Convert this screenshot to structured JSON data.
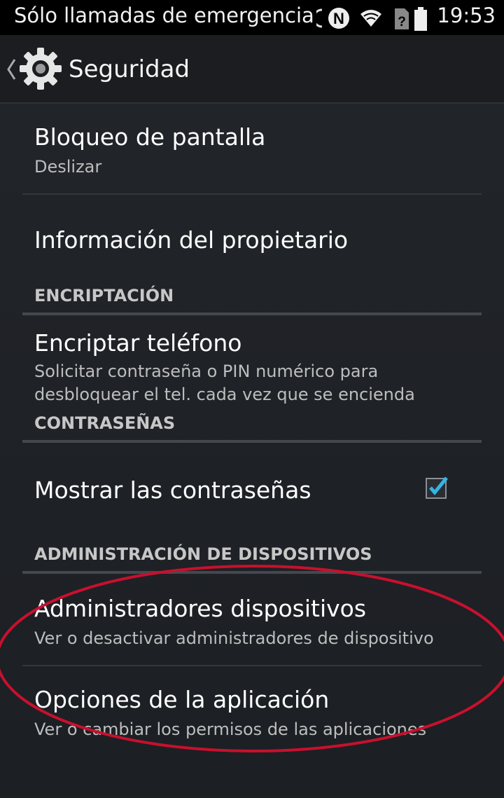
{
  "status_bar": {
    "carrier_text": "Sólo llamadas de emergencia",
    "time": "19:53",
    "icons": [
      "sync-icon",
      "nfc-icon",
      "wifi-icon",
      "no-sim-icon",
      "battery-icon"
    ]
  },
  "action_bar": {
    "title": "Seguridad",
    "icon": "settings-gear-icon",
    "back": "chevron-left-icon"
  },
  "items": {
    "screen_lock": {
      "title": "Bloqueo de pantalla",
      "summary": "Deslizar"
    },
    "owner_info": {
      "title": "Información del propietario"
    },
    "encrypt_header": "ENCRIPTACIÓN",
    "encrypt_phone": {
      "title": "Encriptar teléfono",
      "summary_line1": "Solicitar contraseña o PIN numérico para",
      "summary_line2": "desbloquear el tel. cada vez que se encienda"
    },
    "passwords_header": "CONTRASEÑAS",
    "show_passwords": {
      "title": "Mostrar las contraseñas",
      "checked": true
    },
    "device_admin_header": "ADMINISTRACIÓN DE DISPOSITIVOS",
    "device_admins": {
      "title": "Administradores dispositivos",
      "summary": "Ver o desactivar administradores de dispositivo"
    },
    "app_options": {
      "title": "Opciones de la aplicación",
      "summary": "Ver o cambiar los permisos de las aplicaciones"
    }
  },
  "colors": {
    "background": "#1f2227",
    "accent": "#33b5e5",
    "annotation": "#c8102e"
  }
}
